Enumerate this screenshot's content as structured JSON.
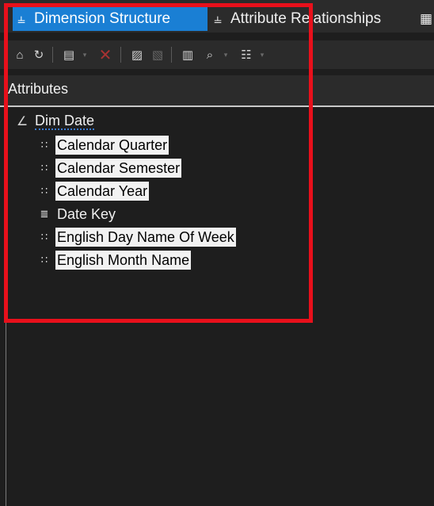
{
  "tabs": [
    {
      "label": "Dimension Structure",
      "icon": "dimension-structure-icon",
      "active": true
    },
    {
      "label": "Attribute Relationships",
      "icon": "attribute-relationships-icon",
      "active": false
    }
  ],
  "toolbar": {
    "buttons": [
      {
        "icon": "add-business-intelligence-icon"
      },
      {
        "icon": "refresh-icon"
      },
      {
        "icon": "show-list-icon"
      },
      {
        "icon": "delete-icon"
      },
      {
        "icon": "show-table-icon"
      },
      {
        "icon": "hide-table-icon"
      },
      {
        "icon": "new-named-query-icon"
      },
      {
        "icon": "find-table-icon"
      },
      {
        "icon": "layout-diagram-icon"
      }
    ]
  },
  "attributes_pane": {
    "title": "Attributes",
    "root": {
      "label": "Dim Date",
      "icon": "dimension-icon"
    },
    "items": [
      {
        "label": "Calendar Quarter",
        "icon": "attribute-icon"
      },
      {
        "label": "Calendar Semester",
        "icon": "attribute-icon"
      },
      {
        "label": "Calendar Year",
        "icon": "attribute-icon"
      },
      {
        "label": "Date Key",
        "icon": "key-attribute-icon"
      },
      {
        "label": "English Day Name Of Week",
        "icon": "attribute-icon"
      },
      {
        "label": "English Month Name",
        "icon": "attribute-icon"
      }
    ]
  },
  "colors": {
    "active_tab": "#1a7fd4",
    "background": "#1e1e1e",
    "panel": "#2b2b2b",
    "highlight_border": "#e8101b",
    "selected_item_bg": "#f2f2f2"
  }
}
